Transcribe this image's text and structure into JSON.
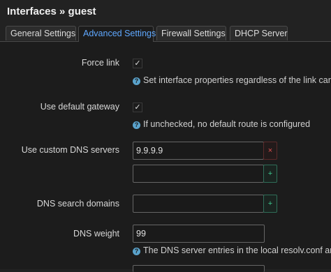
{
  "page": {
    "title": "Interfaces » guest"
  },
  "tabs": [
    {
      "label": "General Settings",
      "active": false
    },
    {
      "label": "Advanced Settings",
      "active": true
    },
    {
      "label": "Firewall Settings",
      "active": false
    },
    {
      "label": "DHCP Server",
      "active": false
    }
  ],
  "fields": {
    "force_link": {
      "label": "Force link",
      "checked": true,
      "help": "Set interface properties regardless of the link carrier"
    },
    "default_gateway": {
      "label": "Use default gateway",
      "checked": true,
      "help": "If unchecked, no default route is configured"
    },
    "custom_dns": {
      "label": "Use custom DNS servers",
      "entries": [
        "9.9.9.9"
      ],
      "new_value": "",
      "remove_glyph": "×",
      "add_glyph": "+"
    },
    "dns_search": {
      "label": "DNS search domains",
      "new_value": "",
      "add_glyph": "+"
    },
    "dns_weight": {
      "label": "DNS weight",
      "value": "99",
      "help": "The DNS server entries in the local resolv.conf are p"
    }
  },
  "icons": {
    "help": "?",
    "check": "✓"
  },
  "colors": {
    "accent": "#5fa8ff",
    "add": "#3ecb92",
    "remove": "#e05050",
    "help_icon": "#5aa3cc"
  }
}
